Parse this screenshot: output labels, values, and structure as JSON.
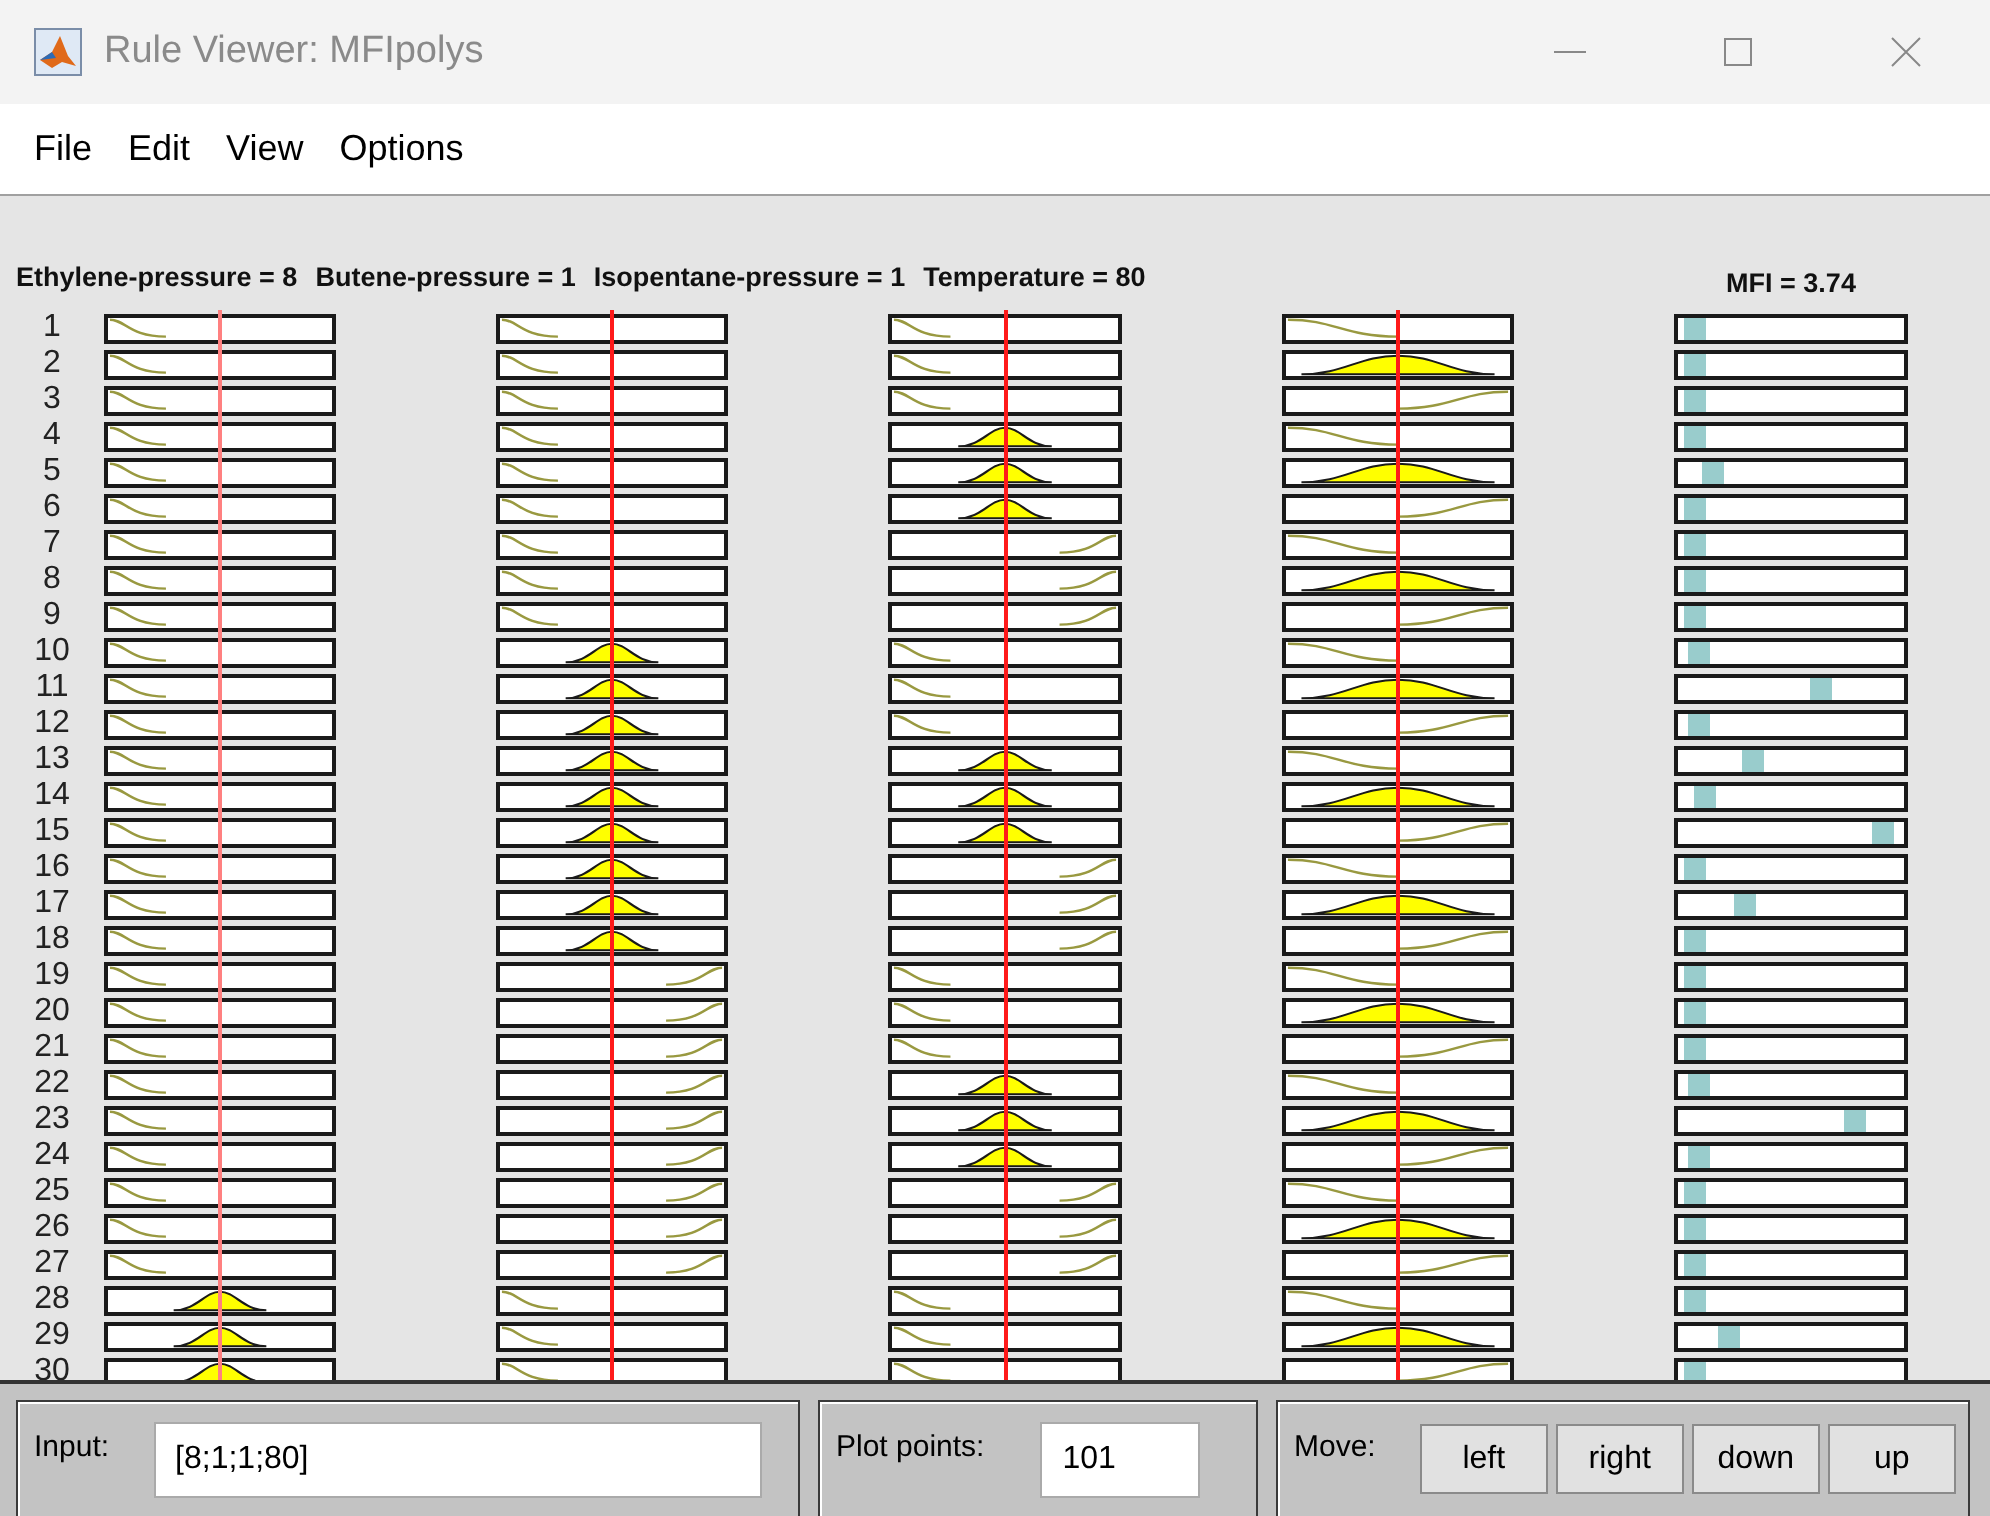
{
  "window": {
    "title": "Rule Viewer: MFIpolys"
  },
  "menu": [
    {
      "label": "File"
    },
    {
      "label": "Edit"
    },
    {
      "label": "View"
    },
    {
      "label": "Options"
    }
  ],
  "inputs": [
    {
      "header": "Ethylene-pressure = 8",
      "kind": "narrow"
    },
    {
      "header": "Butene-pressure = 1",
      "kind": "narrow"
    },
    {
      "header": "Isopentane-pressure = 1",
      "kind": "narrow"
    },
    {
      "header": "Temperature = 80",
      "kind": "wide"
    }
  ],
  "output": {
    "header": "MFI = 3.74"
  },
  "rules": [
    {
      "number": "1",
      "mfs": [
        {
          "kind": "low"
        },
        {
          "kind": "low"
        },
        {
          "kind": "low"
        },
        {
          "kind": "low"
        }
      ],
      "level": 0.08
    },
    {
      "number": "2",
      "mfs": [
        {
          "kind": "low"
        },
        {
          "kind": "low"
        },
        {
          "kind": "low"
        },
        {
          "kind": "mid"
        }
      ],
      "level": 0.08
    },
    {
      "number": "3",
      "mfs": [
        {
          "kind": "low"
        },
        {
          "kind": "low"
        },
        {
          "kind": "low"
        },
        {
          "kind": "high"
        }
      ],
      "level": 0.08
    },
    {
      "number": "4",
      "mfs": [
        {
          "kind": "low"
        },
        {
          "kind": "low"
        },
        {
          "kind": "mid"
        },
        {
          "kind": "low"
        }
      ],
      "level": 0.08
    },
    {
      "number": "5",
      "mfs": [
        {
          "kind": "low"
        },
        {
          "kind": "low"
        },
        {
          "kind": "mid"
        },
        {
          "kind": "mid"
        }
      ],
      "level": 0.16
    },
    {
      "number": "6",
      "mfs": [
        {
          "kind": "low"
        },
        {
          "kind": "low"
        },
        {
          "kind": "mid"
        },
        {
          "kind": "high"
        }
      ],
      "level": 0.08
    },
    {
      "number": "7",
      "mfs": [
        {
          "kind": "low"
        },
        {
          "kind": "low"
        },
        {
          "kind": "high"
        },
        {
          "kind": "low"
        }
      ],
      "level": 0.08
    },
    {
      "number": "8",
      "mfs": [
        {
          "kind": "low"
        },
        {
          "kind": "low"
        },
        {
          "kind": "high"
        },
        {
          "kind": "mid"
        }
      ],
      "level": 0.08
    },
    {
      "number": "9",
      "mfs": [
        {
          "kind": "low"
        },
        {
          "kind": "low"
        },
        {
          "kind": "high"
        },
        {
          "kind": "high"
        }
      ],
      "level": 0.08
    },
    {
      "number": "10",
      "mfs": [
        {
          "kind": "low"
        },
        {
          "kind": "mid"
        },
        {
          "kind": "low"
        },
        {
          "kind": "low"
        }
      ],
      "level": 0.1
    },
    {
      "number": "11",
      "mfs": [
        {
          "kind": "low"
        },
        {
          "kind": "mid"
        },
        {
          "kind": "low"
        },
        {
          "kind": "mid"
        }
      ],
      "level": 0.64
    },
    {
      "number": "12",
      "mfs": [
        {
          "kind": "low"
        },
        {
          "kind": "mid"
        },
        {
          "kind": "low"
        },
        {
          "kind": "high"
        }
      ],
      "level": 0.1
    },
    {
      "number": "13",
      "mfs": [
        {
          "kind": "low"
        },
        {
          "kind": "mid"
        },
        {
          "kind": "mid"
        },
        {
          "kind": "low"
        }
      ],
      "level": 0.34
    },
    {
      "number": "14",
      "mfs": [
        {
          "kind": "low"
        },
        {
          "kind": "mid"
        },
        {
          "kind": "mid"
        },
        {
          "kind": "mid"
        }
      ],
      "level": 0.12
    },
    {
      "number": "15",
      "mfs": [
        {
          "kind": "low"
        },
        {
          "kind": "mid"
        },
        {
          "kind": "mid"
        },
        {
          "kind": "high"
        }
      ],
      "level": 0.91
    },
    {
      "number": "16",
      "mfs": [
        {
          "kind": "low"
        },
        {
          "kind": "mid"
        },
        {
          "kind": "high"
        },
        {
          "kind": "low"
        }
      ],
      "level": 0.08
    },
    {
      "number": "17",
      "mfs": [
        {
          "kind": "low"
        },
        {
          "kind": "mid"
        },
        {
          "kind": "high"
        },
        {
          "kind": "mid"
        }
      ],
      "level": 0.3
    },
    {
      "number": "18",
      "mfs": [
        {
          "kind": "low"
        },
        {
          "kind": "mid"
        },
        {
          "kind": "high"
        },
        {
          "kind": "high"
        }
      ],
      "level": 0.08
    },
    {
      "number": "19",
      "mfs": [
        {
          "kind": "low"
        },
        {
          "kind": "high"
        },
        {
          "kind": "low"
        },
        {
          "kind": "low"
        }
      ],
      "level": 0.08
    },
    {
      "number": "20",
      "mfs": [
        {
          "kind": "low"
        },
        {
          "kind": "high"
        },
        {
          "kind": "low"
        },
        {
          "kind": "mid"
        }
      ],
      "level": 0.08
    },
    {
      "number": "21",
      "mfs": [
        {
          "kind": "low"
        },
        {
          "kind": "high"
        },
        {
          "kind": "low"
        },
        {
          "kind": "high"
        }
      ],
      "level": 0.08
    },
    {
      "number": "22",
      "mfs": [
        {
          "kind": "low"
        },
        {
          "kind": "high"
        },
        {
          "kind": "mid"
        },
        {
          "kind": "low"
        }
      ],
      "level": 0.1
    },
    {
      "number": "23",
      "mfs": [
        {
          "kind": "low"
        },
        {
          "kind": "high"
        },
        {
          "kind": "mid"
        },
        {
          "kind": "mid"
        }
      ],
      "level": 0.79
    },
    {
      "number": "24",
      "mfs": [
        {
          "kind": "low"
        },
        {
          "kind": "high"
        },
        {
          "kind": "mid"
        },
        {
          "kind": "high"
        }
      ],
      "level": 0.1
    },
    {
      "number": "25",
      "mfs": [
        {
          "kind": "low"
        },
        {
          "kind": "high"
        },
        {
          "kind": "high"
        },
        {
          "kind": "low"
        }
      ],
      "level": 0.08
    },
    {
      "number": "26",
      "mfs": [
        {
          "kind": "low"
        },
        {
          "kind": "high"
        },
        {
          "kind": "high"
        },
        {
          "kind": "mid"
        }
      ],
      "level": 0.08
    },
    {
      "number": "27",
      "mfs": [
        {
          "kind": "low"
        },
        {
          "kind": "high"
        },
        {
          "kind": "high"
        },
        {
          "kind": "high"
        }
      ],
      "level": 0.08
    },
    {
      "number": "28",
      "mfs": [
        {
          "kind": "mid"
        },
        {
          "kind": "low"
        },
        {
          "kind": "low"
        },
        {
          "kind": "low"
        }
      ],
      "level": 0.08
    },
    {
      "number": "29",
      "mfs": [
        {
          "kind": "mid"
        },
        {
          "kind": "low"
        },
        {
          "kind": "low"
        },
        {
          "kind": "mid"
        }
      ],
      "level": 0.23
    },
    {
      "number": "30",
      "mfs": [
        {
          "kind": "mid"
        },
        {
          "kind": "low"
        },
        {
          "kind": "low"
        },
        {
          "kind": "high"
        }
      ],
      "level": 0.08
    }
  ],
  "input_field": {
    "label": "Input:",
    "value": "[8;1;1;80]"
  },
  "plot_points": {
    "label": "Plot points:",
    "value": "101"
  },
  "move": {
    "label": "Move:",
    "buttons": [
      {
        "label": "left"
      },
      {
        "label": "right"
      },
      {
        "label": "down"
      },
      {
        "label": "up"
      }
    ]
  }
}
